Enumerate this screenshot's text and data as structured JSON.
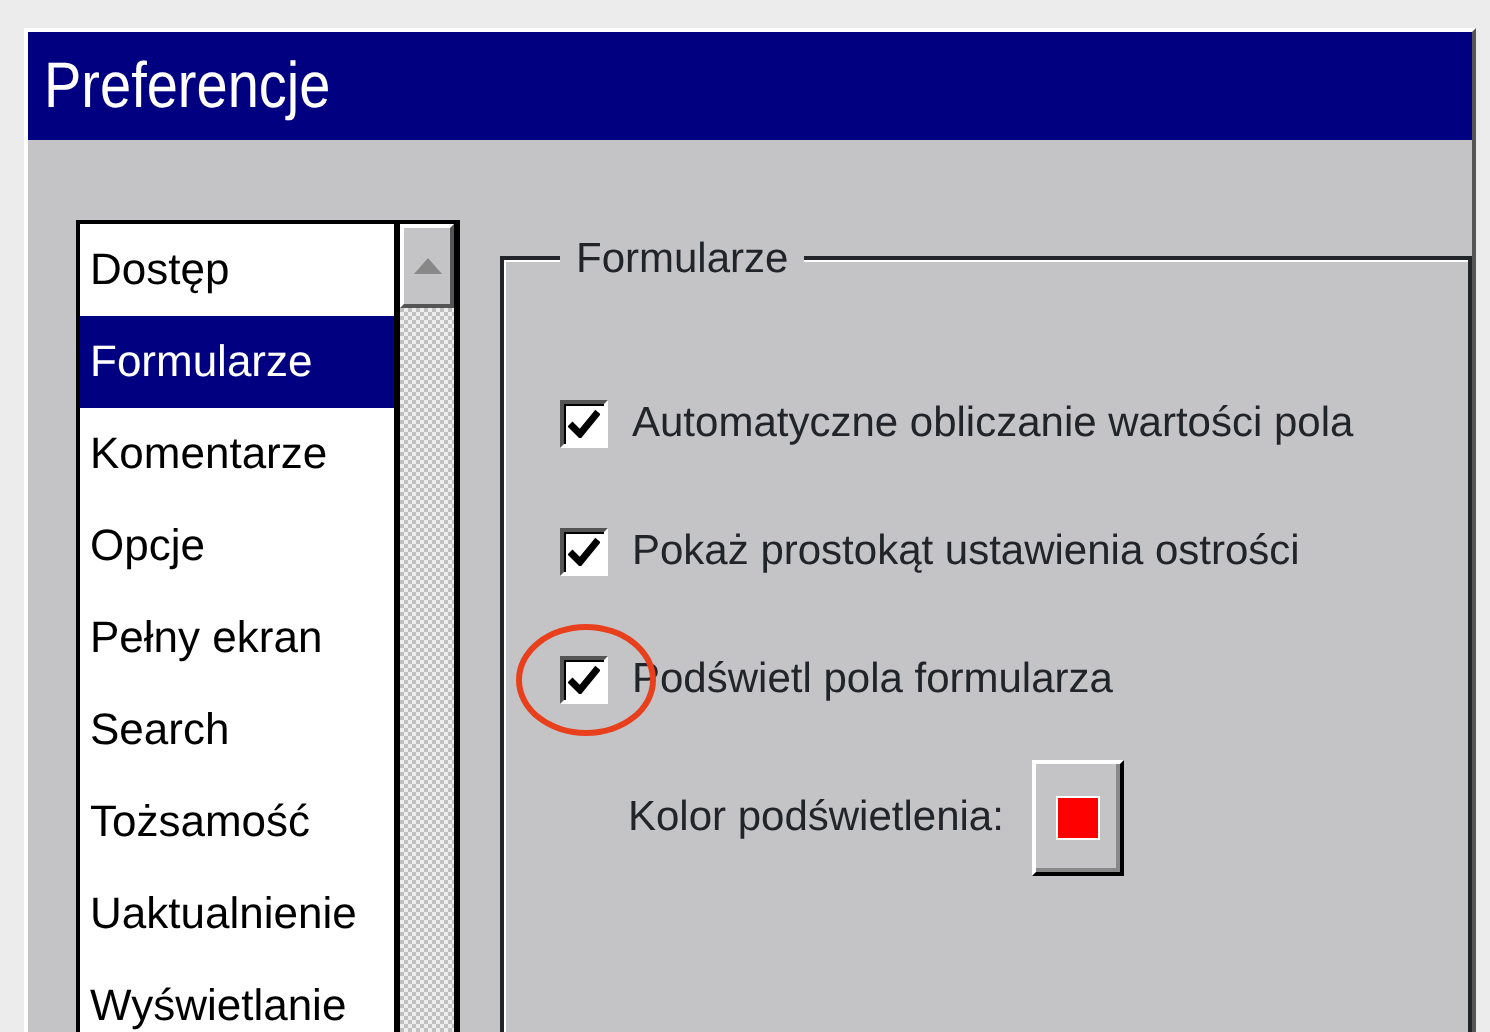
{
  "window": {
    "title": "Preferencje"
  },
  "categories": [
    {
      "label": "Dostęp",
      "selected": false
    },
    {
      "label": "Formularze",
      "selected": true
    },
    {
      "label": "Komentarze",
      "selected": false
    },
    {
      "label": "Opcje",
      "selected": false
    },
    {
      "label": "Pełny ekran",
      "selected": false
    },
    {
      "label": "Search",
      "selected": false
    },
    {
      "label": "Tożsamość",
      "selected": false
    },
    {
      "label": "Uaktualnienie",
      "selected": false
    },
    {
      "label": "Wyświetlanie",
      "selected": false
    }
  ],
  "group": {
    "title": "Formularze",
    "options": [
      {
        "label": "Automatyczne obliczanie wartości pola",
        "checked": true,
        "circled": false
      },
      {
        "label": "Pokaż prostokąt ustawienia ostrości",
        "checked": true,
        "circled": false
      },
      {
        "label": "Podświetl pola formularza",
        "checked": true,
        "circled": true
      }
    ],
    "highlight_color": {
      "label": "Kolor podświetlenia:",
      "color": "#ff0000"
    }
  }
}
